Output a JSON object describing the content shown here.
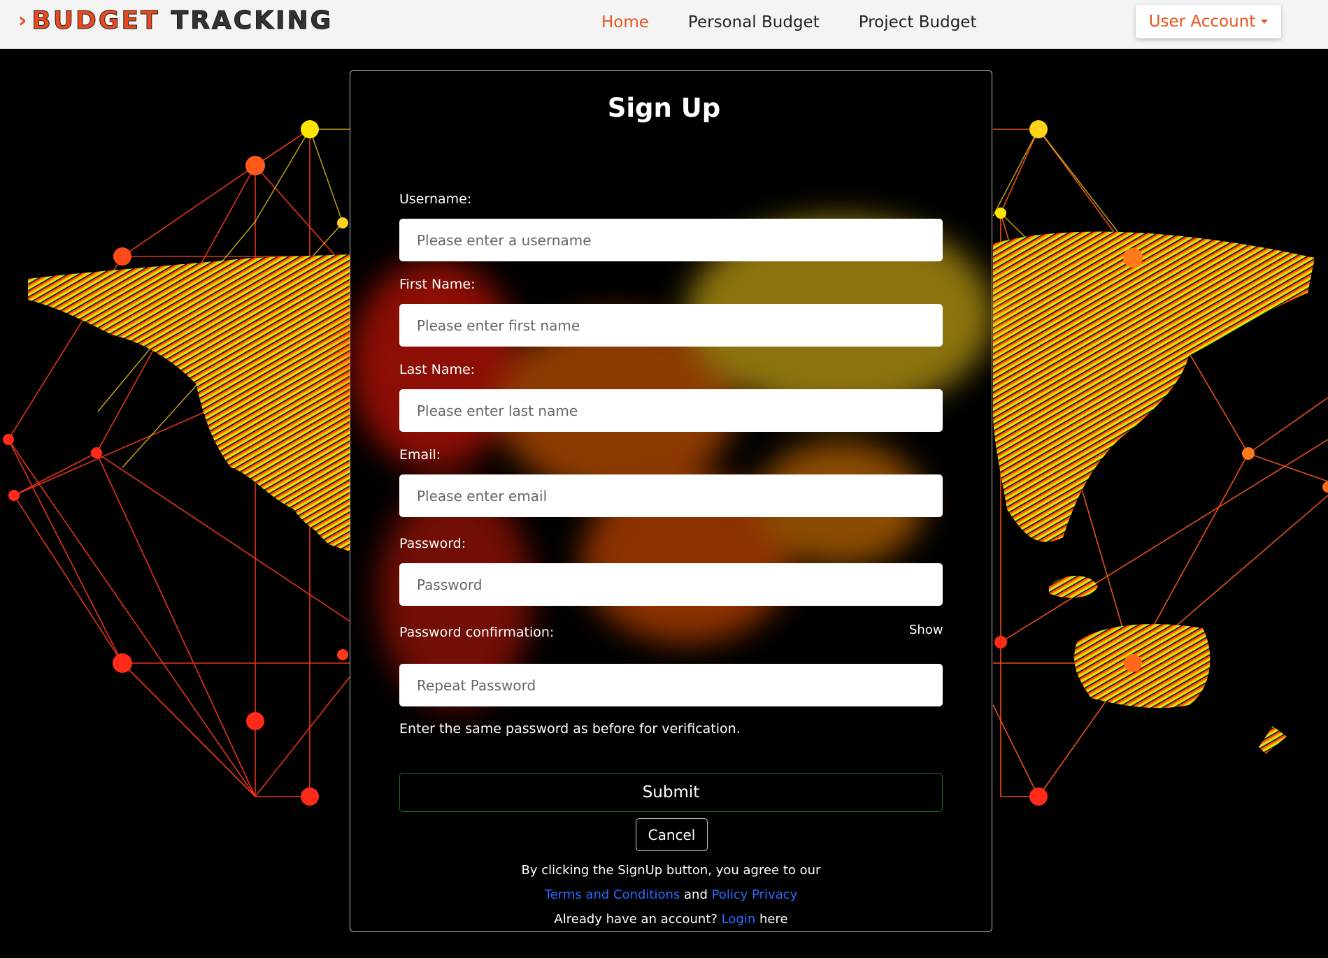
{
  "nav": {
    "brand_part1": "BUDGET",
    "brand_part2": "TRACKING",
    "links": [
      "Home",
      "Personal Budget",
      "Project Budget"
    ],
    "account": "User Account"
  },
  "form": {
    "title": "Sign Up",
    "username_label": "Username:",
    "username_placeholder": "Please enter a username",
    "first_name_label": "First Name:",
    "first_name_placeholder": "Please enter first name",
    "last_name_label": "Last Name:",
    "last_name_placeholder": "Please enter last name",
    "email_label": "Email:",
    "email_placeholder": "Please enter email",
    "password_label": "Password:",
    "password_placeholder": "Password",
    "confirm_label": "Password confirmation:",
    "show_label": "Show",
    "confirm_placeholder": "Repeat Password",
    "helper": "Enter the same password as before for verification.",
    "submit": "Submit",
    "cancel": "Cancel"
  },
  "footer": {
    "agree_text": "By clicking the SignUp button, you agree to our",
    "terms_link": "Terms and Conditions",
    "and": "and",
    "policy_link": "Policy Privacy",
    "have_account": "Already have an account?",
    "login_link": "Login",
    "here": "here"
  },
  "colors": {
    "accent": "#e8561d",
    "link": "#2a6bff",
    "submit_border": "#1f6d1f"
  }
}
